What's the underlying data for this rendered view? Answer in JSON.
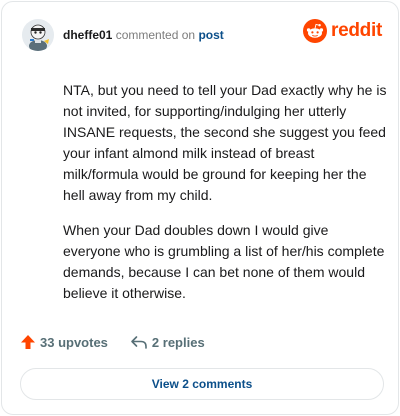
{
  "header": {
    "username": "dheffe01",
    "action_text": "commented on",
    "target_link": "post",
    "brand_name": "reddit",
    "brand_color": "#ff4500"
  },
  "comment": {
    "paragraphs": [
      "NTA, but you need to tell your Dad exactly why he is not invited, for supporting/indulging her utterly INSANE requests, the second she suggest you feed your infant almond milk instead of breast milk/formula would be ground for keeping her the hell away from my child.",
      "When your Dad doubles down I would give everyone who is grumbling a list of her/his complete demands, because I can bet none of them would believe it otherwise."
    ]
  },
  "actions": {
    "upvotes": "33 upvotes",
    "replies": "2 replies",
    "upvote_icon": "upvote-arrow-icon",
    "reply_icon": "reply-arrow-icon"
  },
  "footer": {
    "view_comments_label": "View 2 comments"
  }
}
